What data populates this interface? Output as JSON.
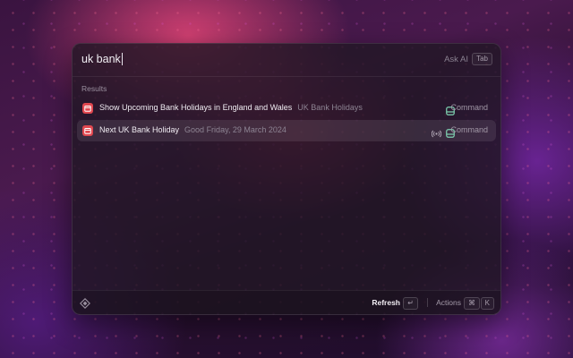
{
  "search": {
    "query": "uk bank",
    "ask_ai_label": "Ask AI",
    "ask_ai_shortcut": "Tab"
  },
  "results": {
    "section_label": "Results",
    "items": [
      {
        "icon": "calendar-icon",
        "title": "Show Upcoming Bank Holidays in England and Wales",
        "subtitle": "UK Bank Holidays",
        "type": "Command",
        "live": false,
        "selected": false
      },
      {
        "icon": "calendar-icon",
        "title": "Next UK Bank Holiday",
        "subtitle": "Good Friday, 29 March 2024",
        "type": "Command",
        "live": true,
        "selected": true
      }
    ]
  },
  "footer": {
    "primary_action": "Refresh",
    "primary_shortcut": "↵",
    "actions_label": "Actions",
    "actions_shortcut_modifier": "⌘",
    "actions_shortcut_key": "K"
  },
  "colors": {
    "accent": "#e0474f",
    "command_icon": "#7fd3b2"
  }
}
